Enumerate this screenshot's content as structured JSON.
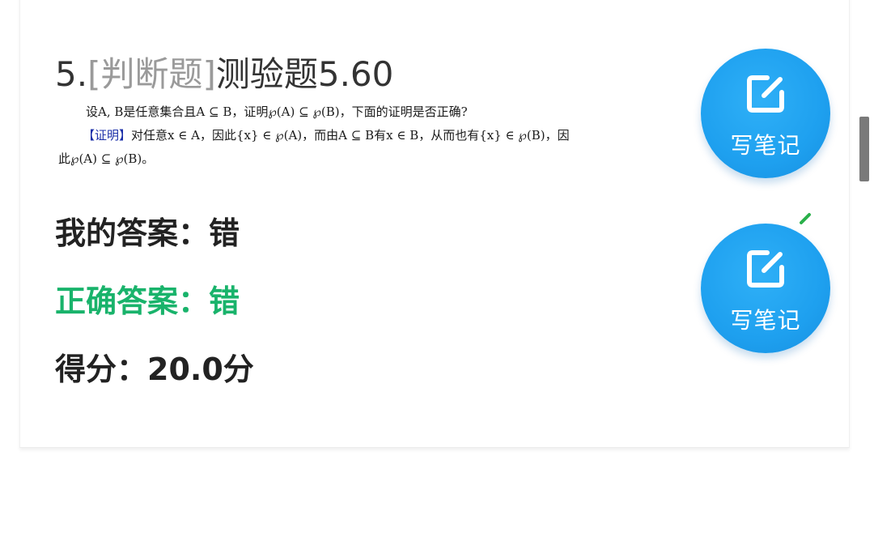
{
  "question": {
    "number": "5.",
    "type": "[判断题]",
    "title": "测验题5.60",
    "line1": "设A, B是任意集合且A ⊆ B，证明℘(A) ⊆ ℘(B)，下面的证明是否正确?",
    "proof_label": "【证明】",
    "line2": "对任意x ∈ A，因此{x} ∈ ℘(A)，而由A ⊆ B有x ∈ B，从而也有{x} ∈ ℘(B)，因",
    "line3": "此℘(A) ⊆ ℘(B)。"
  },
  "answers": {
    "my_answer": "我的答案：错",
    "correct_answer": "正确答案：错",
    "score": "得分：20.0分"
  },
  "note_buttons": [
    {
      "label": "写笔记",
      "icon": "edit-note-icon"
    },
    {
      "label": "写笔记",
      "icon": "edit-note-icon"
    }
  ],
  "colors": {
    "accent_blue": "#1ea0ef",
    "correct_green": "#19b36b",
    "proof_label_blue": "#1a2ea8",
    "question_type_gray": "#9a9a9a"
  }
}
